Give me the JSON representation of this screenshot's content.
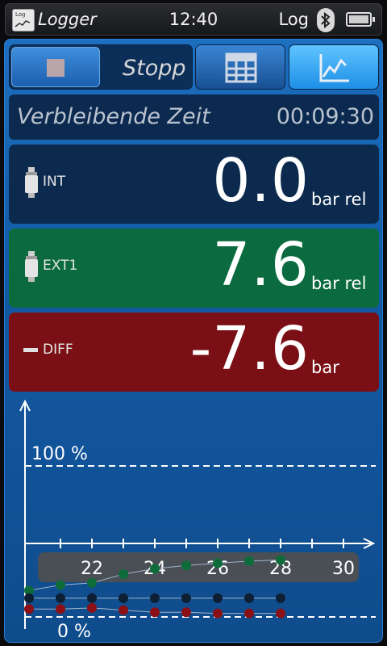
{
  "status": {
    "app_title": "Logger",
    "app_icon_text": "Log",
    "time": "12:40",
    "mode_label": "Log",
    "icons": [
      "logger-app-icon",
      "bluetooth-icon",
      "battery-icon"
    ]
  },
  "toolbar": {
    "stop_label": "Stopp",
    "icons": [
      "stop-icon",
      "table-icon",
      "chart-icon"
    ],
    "active_view": "chart"
  },
  "timer": {
    "label": "Verbleibende Zeit",
    "value": "00:09:30"
  },
  "sensors": [
    {
      "name": "INT",
      "value": "0.0",
      "unit": "bar rel",
      "color": "#0b2a4d",
      "icon": "sensor-icon"
    },
    {
      "name": "EXT1",
      "value": "7.6",
      "unit": "bar rel",
      "color": "#0b6b3e",
      "icon": "sensor-icon"
    },
    {
      "name": "DIFF",
      "value": "-7.6",
      "unit": "bar",
      "color": "#7a1015",
      "icon": "minus-icon"
    }
  ],
  "chart_data": {
    "type": "line",
    "y_top_label": "100 %",
    "y_bottom_label": "0 %",
    "x_ticks": [
      22,
      24,
      26,
      28,
      30
    ],
    "xlim": [
      19,
      30.5
    ],
    "x": [
      20,
      21,
      22,
      23,
      24,
      25,
      26,
      27,
      28
    ],
    "series": [
      {
        "color": "#0e6b3a",
        "values": [
          12,
          17,
          19,
          27,
          32,
          35,
          37,
          39,
          40
        ]
      },
      {
        "color": "#0e1e33",
        "values": [
          5,
          5,
          5,
          5,
          5,
          5,
          5,
          5,
          5
        ]
      },
      {
        "color": "#8a1016",
        "values": [
          -5,
          -5,
          -4,
          -6,
          -8,
          -8,
          -9,
          -9,
          -9
        ]
      }
    ],
    "ylim": [
      -10,
      100
    ]
  }
}
